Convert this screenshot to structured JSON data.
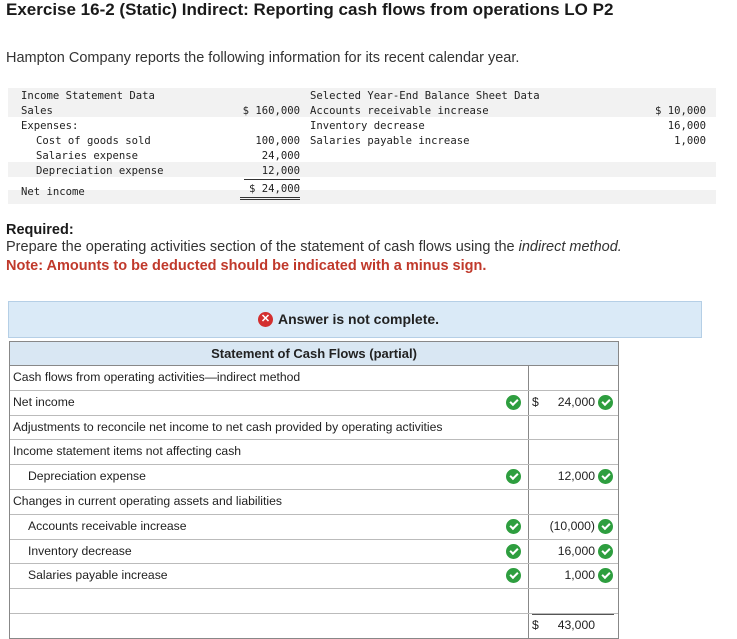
{
  "title": "Exercise 16-2 (Static) Indirect: Reporting cash flows from operations LO P2",
  "intro": "Hampton Company reports the following information for its recent calendar year.",
  "income_statement": {
    "header": "Income Statement Data",
    "sales_label": "Sales",
    "sales_value": "$ 160,000",
    "expenses_label": "Expenses:",
    "cogs_label": "Cost of goods sold",
    "cogs_value": "100,000",
    "salaries_label": "Salaries expense",
    "salaries_value": "24,000",
    "depreciation_label": "Depreciation expense",
    "depreciation_value": "12,000",
    "net_income_label": "Net income",
    "net_income_value": "$ 24,000"
  },
  "balance_sheet": {
    "header": "Selected Year-End Balance Sheet Data",
    "ar_label": "Accounts receivable increase",
    "ar_value": "$ 10,000",
    "inv_label": "Inventory decrease",
    "inv_value": "16,000",
    "sp_label": "Salaries payable increase",
    "sp_value": "1,000"
  },
  "required": {
    "heading": "Required:",
    "text_before": "Prepare the operating activities section of the statement of cash flows using the ",
    "text_em": "indirect method.",
    "note": "Note: Amounts to be deducted should be indicated with a minus sign."
  },
  "banner": {
    "text": "Answer is not complete.",
    "icon": "x-circle-icon",
    "color": "#d32f2f"
  },
  "statement": {
    "title": "Statement of Cash Flows (partial)",
    "rows": [
      {
        "label": "Cash flows from operating activities—indirect method"
      },
      {
        "label": "Net income",
        "dollar": "$",
        "value": "24,000"
      },
      {
        "label": "Adjustments to reconcile net income to net cash provided by operating activities"
      },
      {
        "label": "Income statement items not affecting cash"
      },
      {
        "label": "Depreciation expense",
        "value": "12,000"
      },
      {
        "label": "Changes in current operating assets and liabilities"
      },
      {
        "label": "Accounts receivable increase",
        "value": "(10,000)"
      },
      {
        "label": "Inventory decrease",
        "value": "16,000"
      },
      {
        "label": "Salaries payable increase",
        "value": "1,000"
      },
      {
        "label": ""
      },
      {
        "label": "",
        "dollar": "$",
        "value": "43,000"
      }
    ]
  },
  "check_color": "#2e9e3f"
}
